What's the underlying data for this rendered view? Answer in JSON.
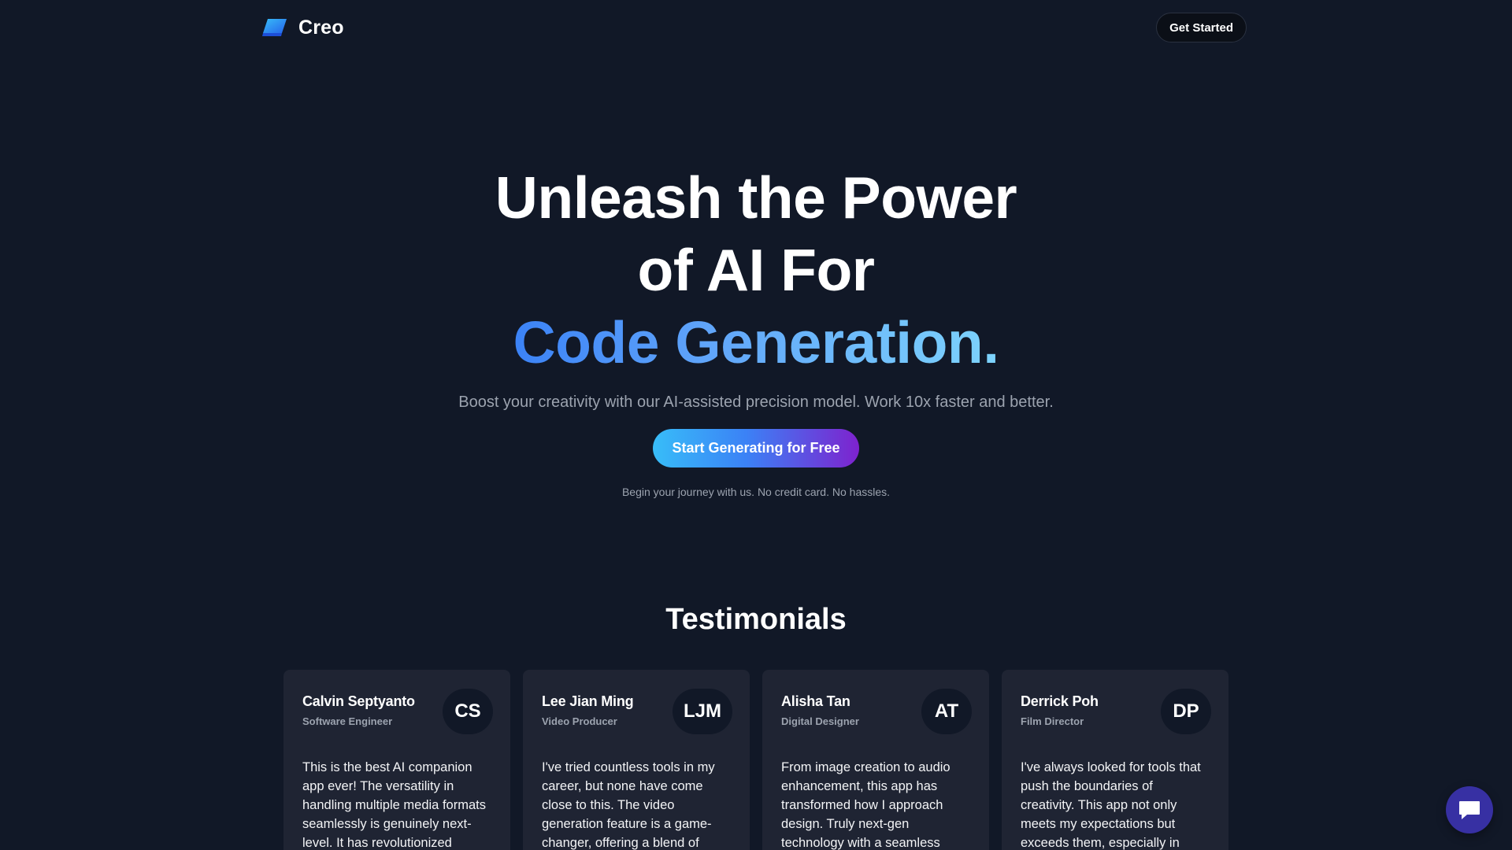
{
  "nav": {
    "brand_name": "Creo",
    "get_started_label": "Get Started"
  },
  "hero": {
    "line1": "Unleash the Power",
    "line2": "of AI For",
    "highlight": "Code Generation.",
    "subtitle": "Boost your creativity with our AI-assisted precision model. Work 10x faster and better.",
    "cta_label": "Start Generating for Free",
    "note": "Begin your journey with us. No credit card. No hassles."
  },
  "testimonials": {
    "title": "Testimonials",
    "items": [
      {
        "name": "Calvin Septyanto",
        "role": "Software Engineer",
        "initials": "CS",
        "text": "This is the best AI companion app ever! The versatility in handling multiple media formats seamlessly is genuinely next-level. It has revolutionized"
      },
      {
        "name": "Lee Jian Ming",
        "role": "Video Producer",
        "initials": "LJM",
        "text": "I've tried countless tools in my career, but none have come close to this. The video generation feature is a game-changer, offering a blend of"
      },
      {
        "name": "Alisha Tan",
        "role": "Digital Designer",
        "initials": "AT",
        "text": "From image creation to audio enhancement, this app has transformed how I approach design. Truly next-gen technology with a seamless"
      },
      {
        "name": "Derrick Poh",
        "role": "Film Director",
        "initials": "DP",
        "text": "I've always looked for tools that push the boundaries of creativity. This app not only meets my expectations but exceeds them, especially in"
      }
    ]
  },
  "icons": {
    "logo": "creo-logo-icon",
    "chat": "chat-icon"
  },
  "colors": {
    "background": "#111827",
    "card": "#1f2433",
    "accent_start": "#38bdf8",
    "accent_end": "#7e22ce",
    "chat_fab": "#3730a3"
  }
}
